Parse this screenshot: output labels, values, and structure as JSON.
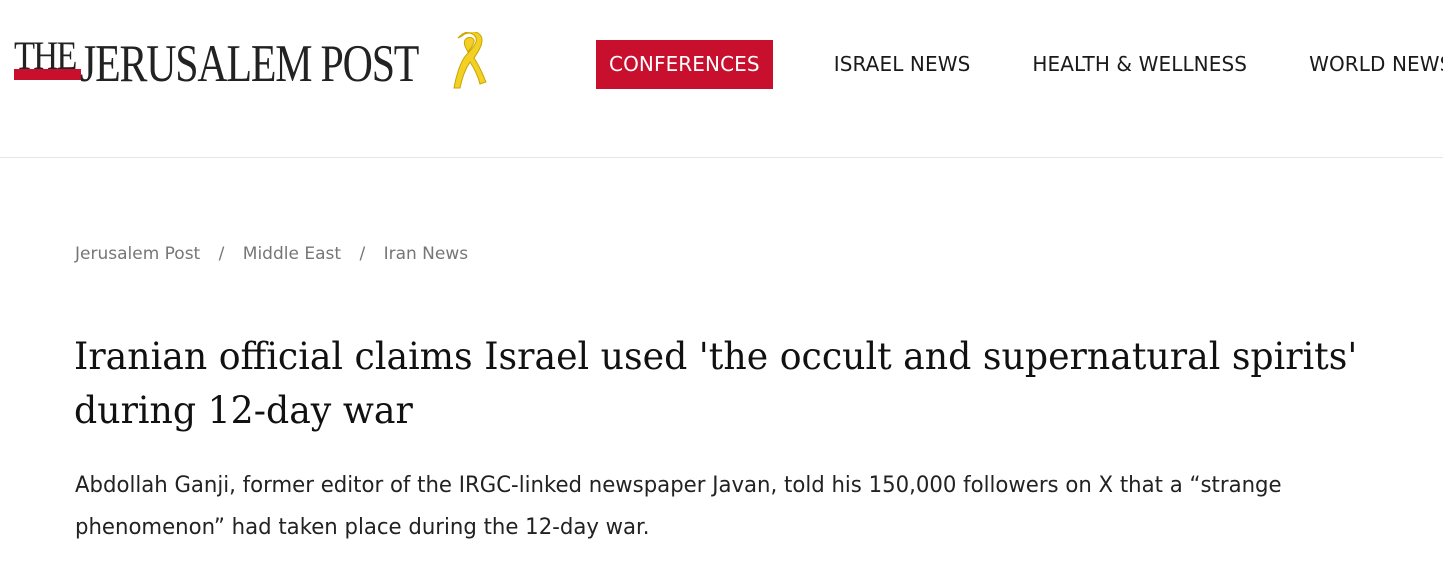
{
  "site": {
    "logo_the": "THE",
    "logo_name": "JERUSALEM POST",
    "brand_color": "#c8102e",
    "ribbon_color": "#f2d024"
  },
  "nav": {
    "items": [
      {
        "label": "CONFERENCES",
        "active": true
      },
      {
        "label": "ISRAEL NEWS",
        "active": false
      },
      {
        "label": "HEALTH & WELLNESS",
        "active": false
      },
      {
        "label": "WORLD NEWS",
        "active": false
      }
    ]
  },
  "breadcrumb": {
    "items": [
      "Jerusalem Post",
      "Middle East",
      "Iran News"
    ],
    "separator": "/"
  },
  "article": {
    "title": "Iranian official claims Israel used 'the occult and supernatural spirits' during 12-day war",
    "summary": "Abdollah Ganji, former editor of the IRGC-linked newspaper Javan, told his 150,000 followers on X that a “strange phenomenon” had taken place during the 12-day war."
  }
}
